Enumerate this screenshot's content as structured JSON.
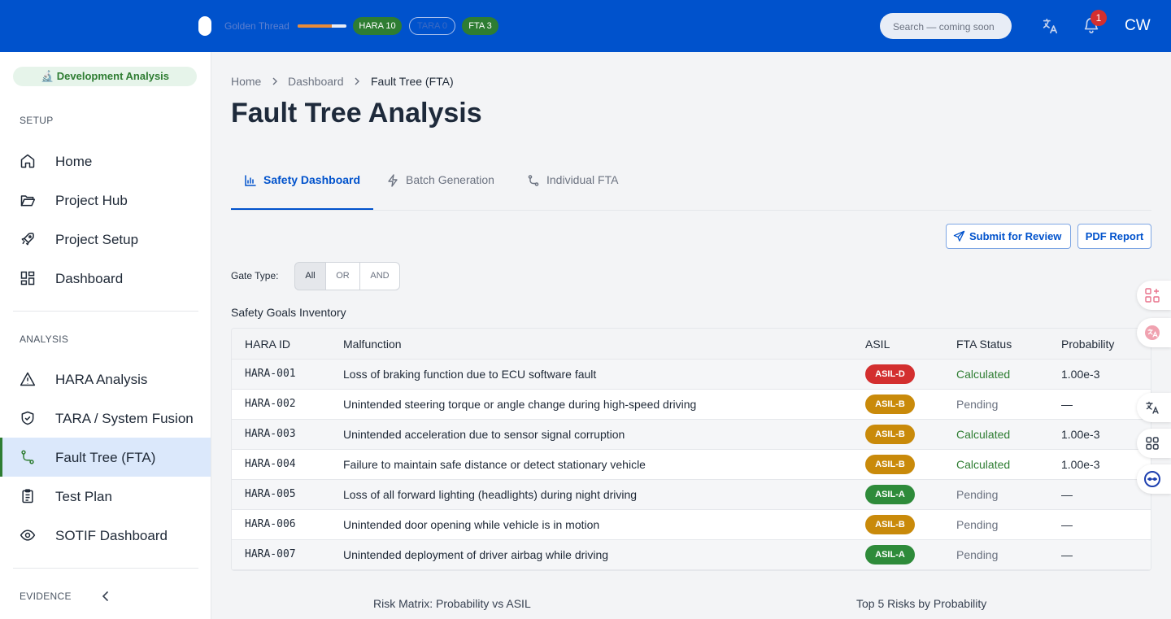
{
  "topbar": {
    "golden_thread_label": "Golden Thread",
    "golden_thread_progress": 0.7,
    "chips": {
      "hara": "HARA 10",
      "tara": "TARA 0",
      "fta": "FTA 3"
    },
    "search_placeholder": "Search — coming soon",
    "notification_count": "1",
    "user_initials": "CW",
    "colors": {
      "bar": "#0052cc",
      "chip_green": "#2e7d32",
      "badge": "#d32f2f"
    }
  },
  "sidebar": {
    "mode": "🔬 Development Analysis",
    "sections": {
      "setup": "SETUP",
      "analysis": "ANALYSIS",
      "evidence": "EVIDENCE"
    },
    "setup_items": [
      {
        "label": "Home",
        "icon": "home-icon"
      },
      {
        "label": "Project Hub",
        "icon": "folder-open-icon"
      },
      {
        "label": "Project Setup",
        "icon": "rocket-icon"
      },
      {
        "label": "Dashboard",
        "icon": "dashboard-grid-icon"
      }
    ],
    "analysis_items": [
      {
        "label": "HARA Analysis",
        "icon": "warning-triangle-icon"
      },
      {
        "label": "TARA / System Fusion",
        "icon": "shield-check-icon"
      },
      {
        "label": "Fault Tree (FTA)",
        "icon": "route-icon",
        "active": true
      },
      {
        "label": "Test Plan",
        "icon": "clipboard-list-icon"
      },
      {
        "label": "SOTIF Dashboard",
        "icon": "eye-icon"
      }
    ]
  },
  "breadcrumb": [
    "Home",
    "Dashboard",
    "Fault Tree (FTA)"
  ],
  "page_title": "Fault Tree Analysis",
  "tabs": [
    {
      "label": "Safety Dashboard",
      "icon": "bar-chart-icon",
      "active": true
    },
    {
      "label": "Batch Generation",
      "icon": "lightning-icon"
    },
    {
      "label": "Individual FTA",
      "icon": "route-icon"
    }
  ],
  "actions": {
    "submit": "Submit for Review",
    "pdf": "PDF Report"
  },
  "gate_filter": {
    "label": "Gate Type:",
    "options": [
      "All",
      "OR",
      "AND"
    ],
    "selected": "All"
  },
  "inventory": {
    "title": "Safety Goals Inventory",
    "columns": [
      "HARA ID",
      "Malfunction",
      "ASIL",
      "FTA Status",
      "Probability"
    ],
    "rows": [
      {
        "id": "HARA-001",
        "malfunction": "Loss of braking function due to ECU software fault",
        "asil": "ASIL-D",
        "status": "Calculated",
        "probability": "1.00e-3"
      },
      {
        "id": "HARA-002",
        "malfunction": "Unintended steering torque or angle change during high-speed driving",
        "asil": "ASIL-B",
        "status": "Pending",
        "probability": "—"
      },
      {
        "id": "HARA-003",
        "malfunction": "Unintended acceleration due to sensor signal corruption",
        "asil": "ASIL-B",
        "status": "Calculated",
        "probability": "1.00e-3"
      },
      {
        "id": "HARA-004",
        "malfunction": "Failure to maintain safe distance or detect stationary vehicle",
        "asil": "ASIL-B",
        "status": "Calculated",
        "probability": "1.00e-3"
      },
      {
        "id": "HARA-005",
        "malfunction": "Loss of all forward lighting (headlights) during night driving",
        "asil": "ASIL-A",
        "status": "Pending",
        "probability": "—"
      },
      {
        "id": "HARA-006",
        "malfunction": "Unintended door opening while vehicle is in motion",
        "asil": "ASIL-B",
        "status": "Pending",
        "probability": "—"
      },
      {
        "id": "HARA-007",
        "malfunction": "Unintended deployment of driver airbag while driving",
        "asil": "ASIL-A",
        "status": "Pending",
        "probability": "—"
      }
    ],
    "asil_colors": {
      "ASIL-D": "#d32f2f",
      "ASIL-B": "#c98a0a",
      "ASIL-A": "#2e8b3a"
    },
    "status_colors": {
      "Calculated": "#2e7d32",
      "Pending": "#6b7280"
    }
  },
  "charts": {
    "risk_matrix_title": "Risk Matrix: Probability vs ASIL",
    "top_risks_title": "Top 5 Risks by Probability"
  }
}
